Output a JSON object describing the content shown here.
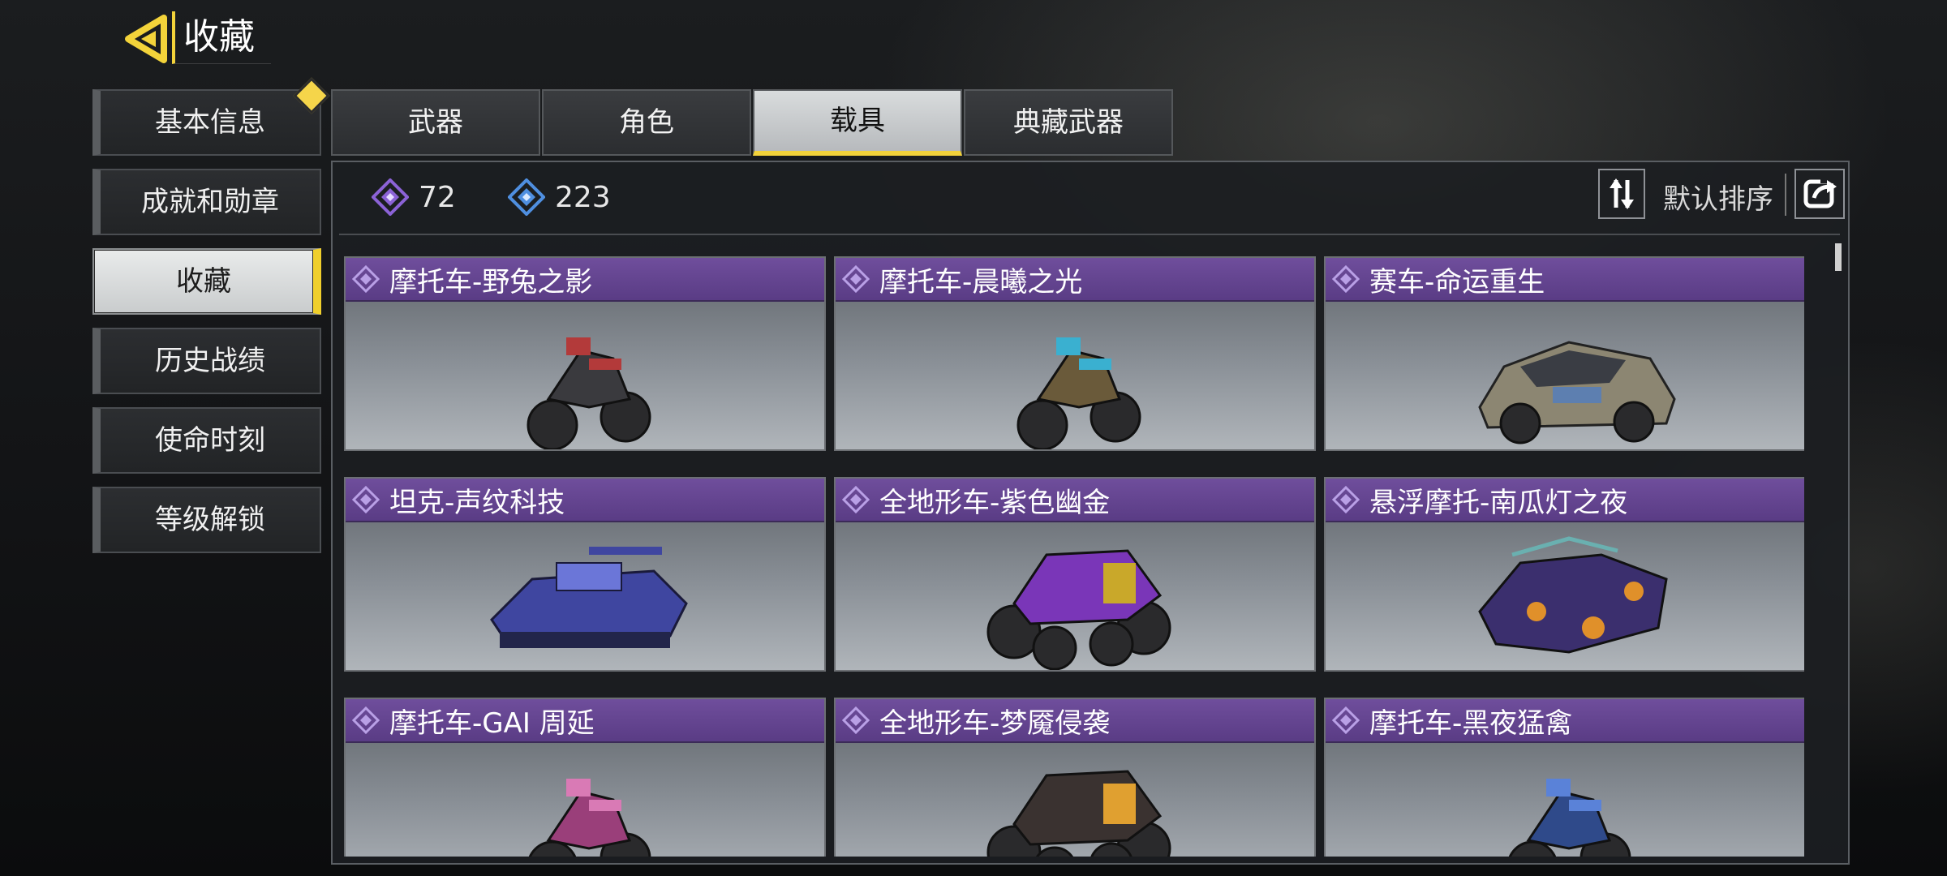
{
  "header": {
    "title": "收藏",
    "back_icon": "back-arrow-icon"
  },
  "sidebar": {
    "items": [
      {
        "label": "基本信息",
        "badge": true
      },
      {
        "label": "成就和勋章"
      },
      {
        "label": "收藏",
        "active": true
      },
      {
        "label": "历史战绩"
      },
      {
        "label": "使命时刻"
      },
      {
        "label": "等级解锁"
      }
    ]
  },
  "tabs": [
    {
      "label": "武器"
    },
    {
      "label": "角色"
    },
    {
      "label": "载具",
      "active": true
    },
    {
      "label": "典藏武器"
    }
  ],
  "stats": {
    "purple_count": "72",
    "blue_count": "223",
    "purple_color": "#8b62d6",
    "blue_color": "#4f8fe0"
  },
  "sort": {
    "label": "默认排序"
  },
  "items": [
    {
      "name": "摩托车-野兔之影",
      "vehicle": "motorcycle",
      "color": "#3a3a3e",
      "accent": "#b33a3a"
    },
    {
      "name": "摩托车-晨曦之光",
      "vehicle": "motorcycle",
      "color": "#6a5a3a",
      "accent": "#3ab0d0"
    },
    {
      "name": "赛车-命运重生",
      "vehicle": "car",
      "color": "#8c8672",
      "accent": "#5d7fb0"
    },
    {
      "name": "坦克-声纹科技",
      "vehicle": "tank",
      "color": "#3f46a0",
      "accent": "#6b76d8"
    },
    {
      "name": "全地形车-紫色幽金",
      "vehicle": "atv",
      "color": "#7a36b8",
      "accent": "#c9a82a"
    },
    {
      "name": "悬浮摩托-南瓜灯之夜",
      "vehicle": "hover",
      "color": "#3b2f6e",
      "accent": "#e0902a"
    },
    {
      "name": "摩托车-GAI 周延",
      "vehicle": "motorcycle",
      "color": "#9a3f7a",
      "accent": "#d97ab5"
    },
    {
      "name": "全地形车-梦魇侵袭",
      "vehicle": "atv",
      "color": "#3a3230",
      "accent": "#e0a030"
    },
    {
      "name": "摩托车-黑夜猛禽",
      "vehicle": "motorcycle",
      "color": "#2f4a8a",
      "accent": "#5a82d8"
    }
  ]
}
